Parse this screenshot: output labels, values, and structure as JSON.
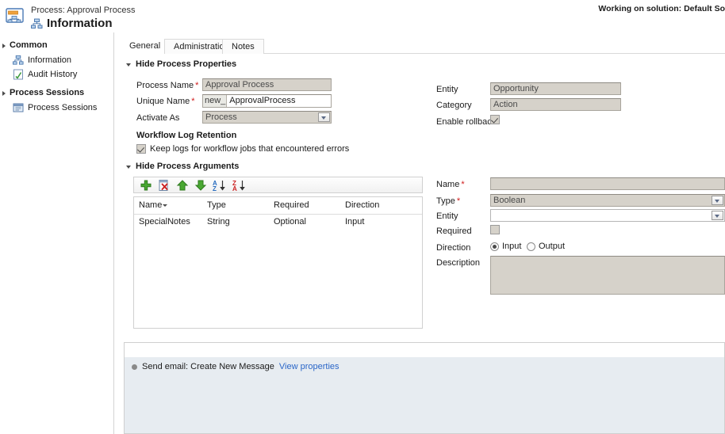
{
  "header": {
    "entity_label": "Process: Approval Process",
    "page_title": "Information",
    "icon": "process-window-icon",
    "title_glyph": "process-node-icon",
    "solution_note": "Working on solution: Default So"
  },
  "sidebar": {
    "groups": [
      {
        "title": "Common",
        "items": [
          {
            "label": "Information",
            "icon": "process-node-icon"
          },
          {
            "label": "Audit History",
            "icon": "audit-history-icon"
          }
        ]
      },
      {
        "title": "Process Sessions",
        "items": [
          {
            "label": "Process Sessions",
            "icon": "process-sessions-icon"
          }
        ]
      }
    ]
  },
  "tabs": [
    {
      "label": "General",
      "active": true
    },
    {
      "label": "Administration",
      "active": false
    },
    {
      "label": "Notes",
      "active": false
    }
  ],
  "process_properties": {
    "section_label": "Hide Process Properties",
    "process_name": {
      "label": "Process Name",
      "value": "Approval Process",
      "required": true
    },
    "unique_name": {
      "label": "Unique Name",
      "prefix": "new_",
      "value": "ApprovalProcess",
      "required": true
    },
    "activate_as": {
      "label": "Activate As",
      "value": "Process",
      "required": false
    },
    "entity": {
      "label": "Entity",
      "value": "Opportunity"
    },
    "category": {
      "label": "Category",
      "value": "Action"
    },
    "enable_rollback": {
      "label": "Enable rollback",
      "checked": true
    }
  },
  "workflow_log_retention": {
    "title": "Workflow Log Retention",
    "keep_logs": {
      "label": "Keep logs for workflow jobs that encountered errors",
      "checked": true
    }
  },
  "process_arguments": {
    "section_label": "Hide Process Arguments",
    "toolbar": [
      {
        "name": "add-argument-button",
        "icon": "plus-icon"
      },
      {
        "name": "delete-argument-button",
        "icon": "delete-page-icon"
      },
      {
        "name": "move-up-button",
        "icon": "arrow-up-icon"
      },
      {
        "name": "move-down-button",
        "icon": "arrow-down-icon"
      },
      {
        "name": "sort-ascending-button",
        "icon": "sort-az-icon"
      },
      {
        "name": "sort-descending-button",
        "icon": "sort-za-icon"
      }
    ],
    "columns": [
      "Name",
      "Type",
      "Required",
      "Direction"
    ],
    "sorted_column": "Name",
    "rows": [
      {
        "name": "SpecialNotes",
        "type": "String",
        "required": "Optional",
        "direction": "Input"
      }
    ],
    "detail": {
      "name": {
        "label": "Name",
        "value": "",
        "required": true
      },
      "type": {
        "label": "Type",
        "value": "Boolean",
        "required": true
      },
      "entity": {
        "label": "Entity",
        "value": ""
      },
      "required": {
        "label": "Required",
        "checked": false
      },
      "direction": {
        "label": "Direction",
        "options": [
          {
            "label": "Input",
            "selected": true
          },
          {
            "label": "Output",
            "selected": false
          }
        ]
      },
      "description": {
        "label": "Description",
        "value": ""
      }
    }
  },
  "steps": {
    "rows": [
      {
        "text": "Send email: Create New Message",
        "link": "View properties"
      }
    ]
  },
  "colors": {
    "required_asterisk": "#d01a1a",
    "link": "#2a66c8",
    "disabled_field": "#d6d2ca",
    "steps_background": "#e7ecf1",
    "toolbar_green": "#3fa13f",
    "sort_letter": "#2a6ec0"
  }
}
